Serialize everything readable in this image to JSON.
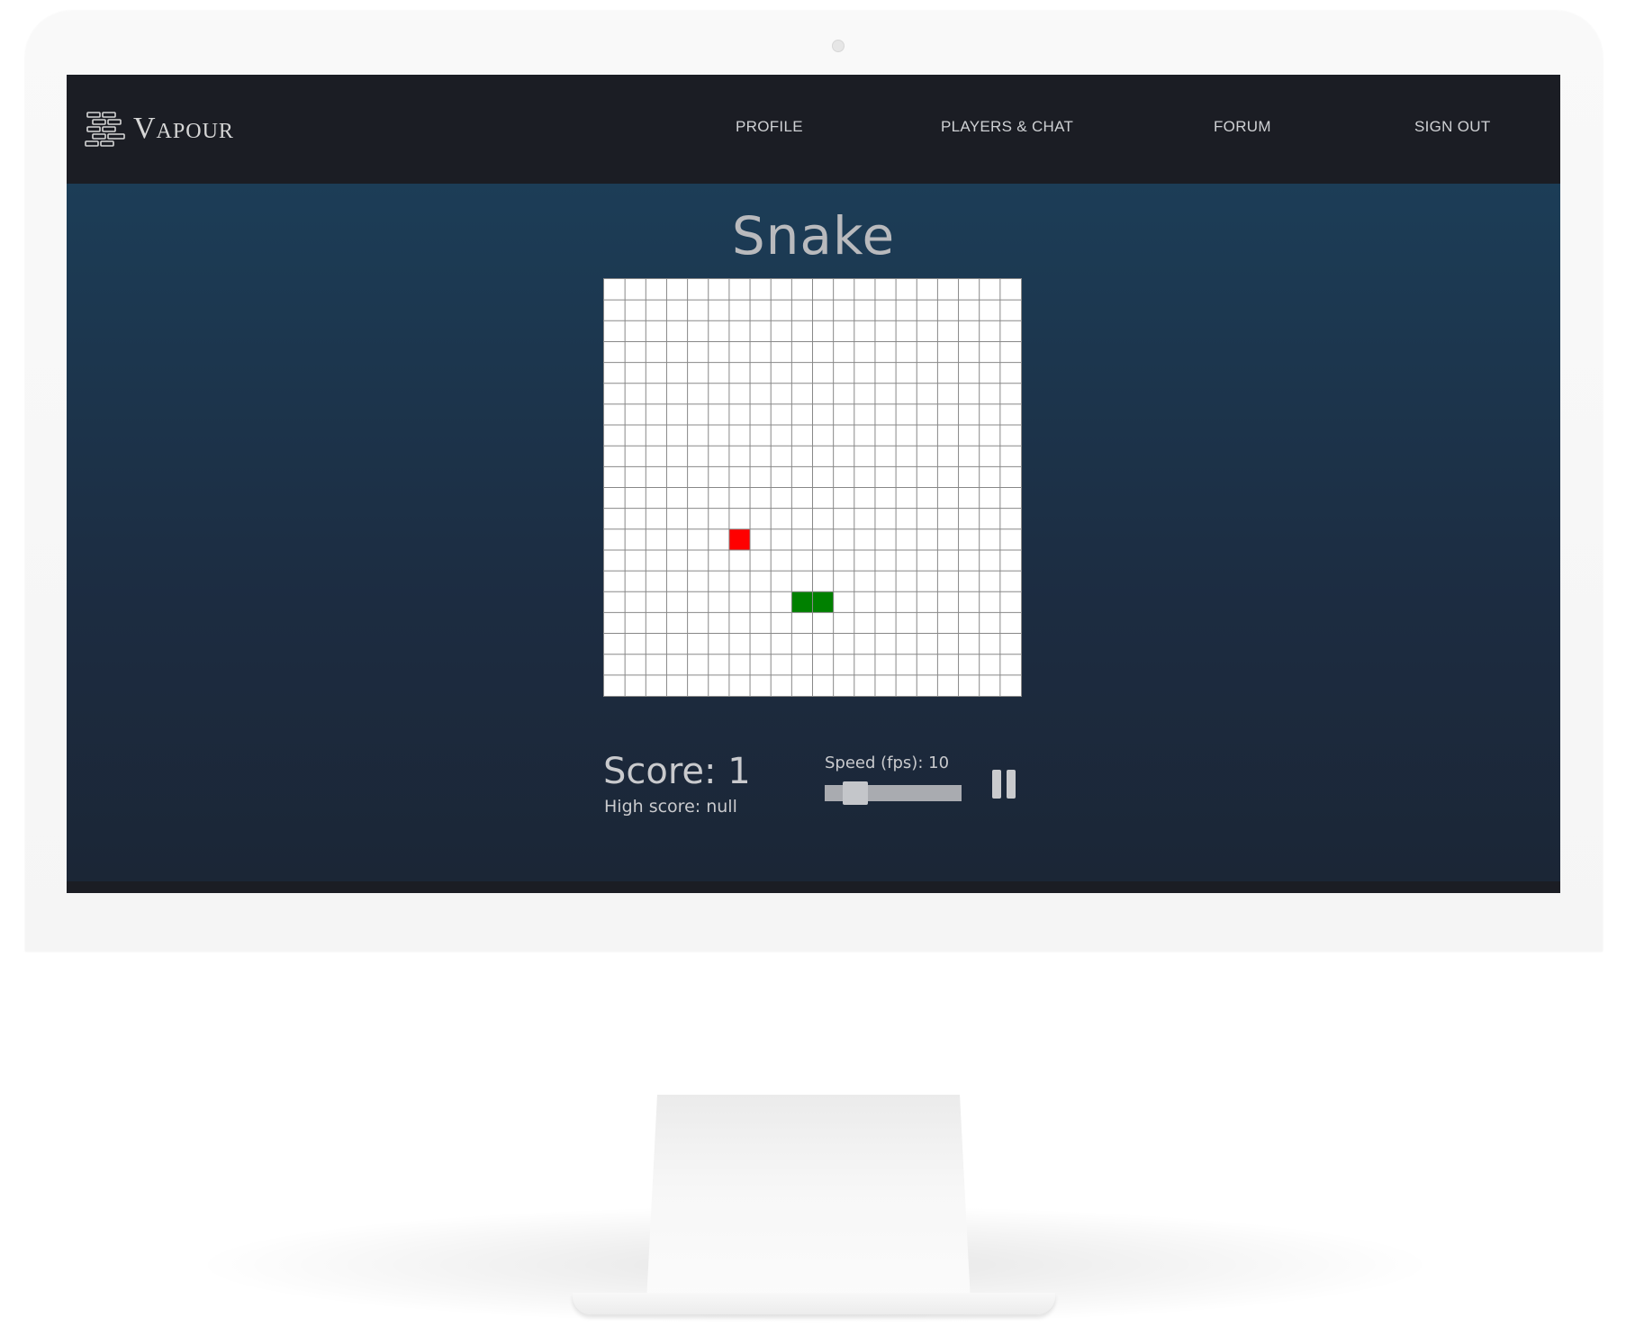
{
  "brand": {
    "name": "Vapour",
    "icon": "brick-stack-icon"
  },
  "nav": {
    "items": [
      {
        "label": "PROFILE"
      },
      {
        "label": "PLAYERS & CHAT"
      },
      {
        "label": "FORUM"
      },
      {
        "label": "SIGN OUT"
      }
    ]
  },
  "game": {
    "title": "Snake",
    "board": {
      "columns": 20,
      "rows": 20,
      "food": {
        "col": 6,
        "row": 12
      },
      "snake": [
        {
          "col": 9,
          "row": 15
        },
        {
          "col": 10,
          "row": 15
        }
      ]
    },
    "score_text": "Score: 1",
    "high_score_text": "High score: null",
    "speed_label": "Speed (fps): 10",
    "speed_value": 10,
    "speed_min": 8,
    "speed_max": 30,
    "pause_icon": "pause-icon"
  },
  "colors": {
    "navbar": "#1b1d24",
    "background_top": "#1c3d57",
    "background_bottom": "#1b2636",
    "food": "#ff0000",
    "snake": "#008000",
    "grid_line": "#888888"
  }
}
